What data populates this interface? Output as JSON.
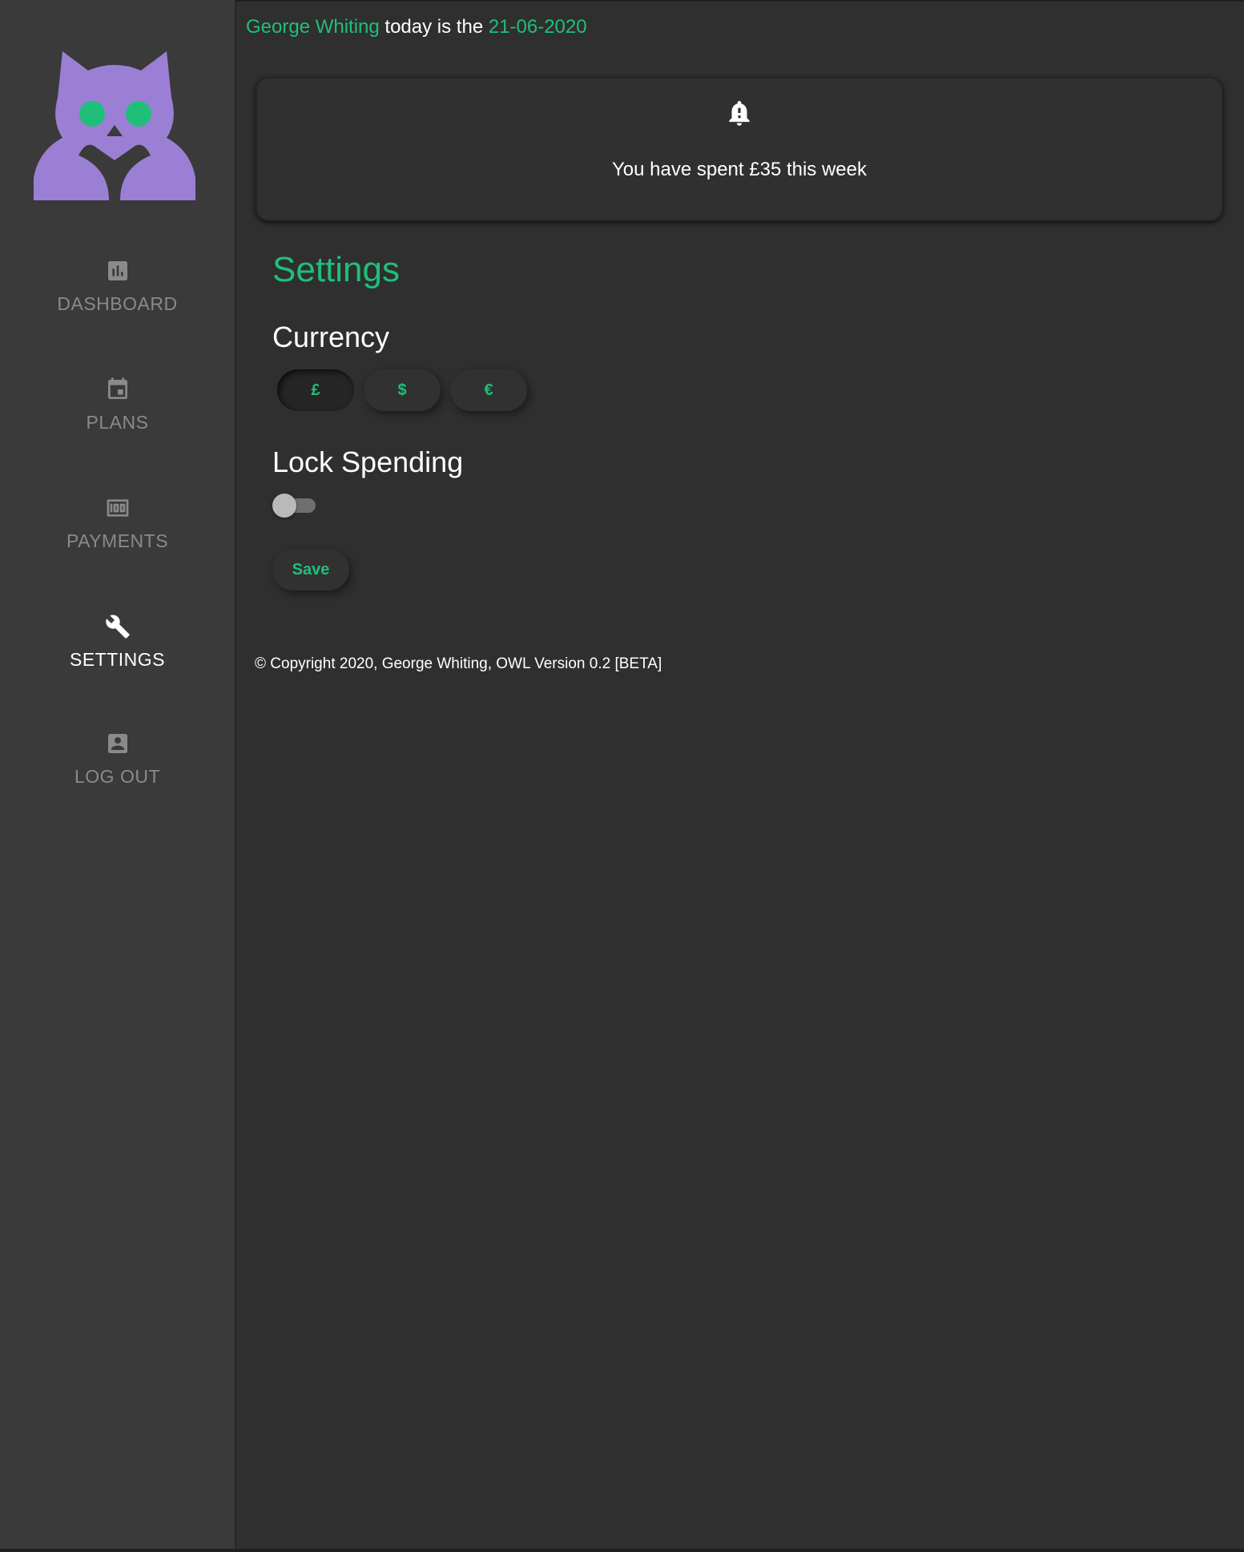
{
  "header": {
    "user_name": "George Whiting",
    "middle_text": " today is the ",
    "date": "21-06-2020"
  },
  "alert": {
    "icon": "bell-alert-icon",
    "message": "You have spent £35 this week"
  },
  "sidebar": {
    "logo": "owl-logo",
    "items": [
      {
        "label": "DASHBOARD",
        "icon": "bar-chart-icon",
        "active": false
      },
      {
        "label": "PLANS",
        "icon": "calendar-icon",
        "active": false
      },
      {
        "label": "PAYMENTS",
        "icon": "money-icon",
        "active": false
      },
      {
        "label": "SETTINGS",
        "icon": "wrench-icon",
        "active": true
      },
      {
        "label": "LOG OUT",
        "icon": "account-box-icon",
        "active": false
      }
    ]
  },
  "settings": {
    "title": "Settings",
    "currency_title": "Currency",
    "currencies": [
      "£",
      "$",
      "€"
    ],
    "selected_currency": "£",
    "lock_title": "Lock Spending",
    "lock_enabled": false,
    "save_label": "Save"
  },
  "footer": {
    "text": "© Copyright 2020, George Whiting, OWL Version 0.2 [BETA]"
  },
  "colors": {
    "accent": "#1fbf7a",
    "owl": "#9b7fd4",
    "sidebar_bg": "#3a3a3a",
    "main_bg": "#2f2f2f"
  }
}
